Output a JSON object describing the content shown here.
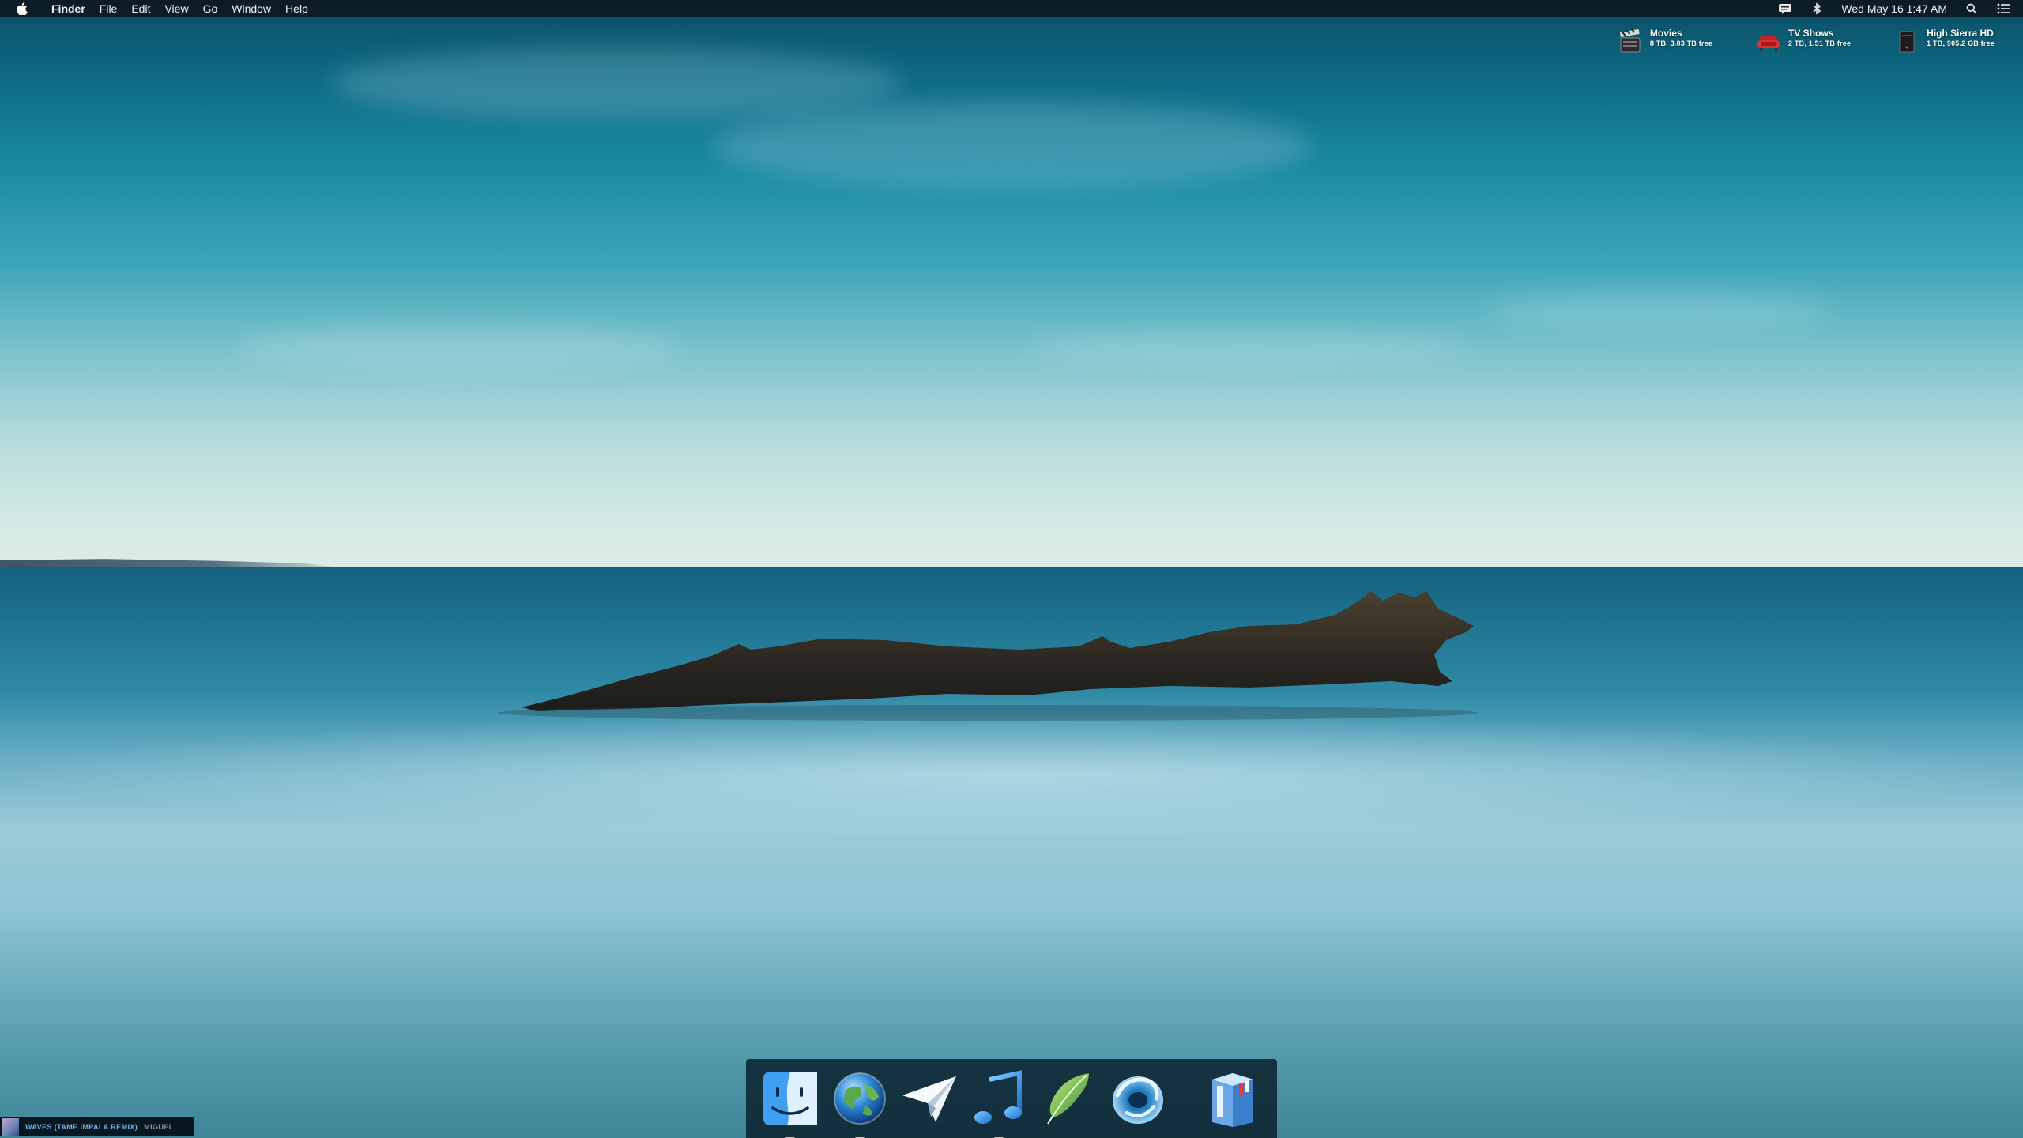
{
  "menubar": {
    "app_name": "Finder",
    "menus": [
      "File",
      "Edit",
      "View",
      "Go",
      "Window",
      "Help"
    ],
    "clock": "Wed May 16  1:47 AM",
    "status_icons": [
      "growl-icon",
      "bluetooth-icon",
      "search-icon",
      "notification-list-icon"
    ]
  },
  "desktop": {
    "drives": [
      {
        "name": "Movies",
        "info": "8 TB, 3.03 TB free",
        "icon": "film-clapper-icon"
      },
      {
        "name": "TV Shows",
        "info": "2 TB, 1.51 TB free",
        "icon": "red-couch-icon"
      },
      {
        "name": "High Sierra HD",
        "info": "1 TB, 905.2 GB free",
        "icon": "hard-drive-icon"
      }
    ]
  },
  "dock": {
    "apps": [
      {
        "name": "Finder",
        "icon": "finder-icon",
        "running": true
      },
      {
        "name": "Browser",
        "icon": "globe-icon",
        "running": true
      },
      {
        "name": "Mail",
        "icon": "paper-plane-icon",
        "running": false
      },
      {
        "name": "Music",
        "icon": "music-note-icon",
        "running": true
      },
      {
        "name": "Feather",
        "icon": "feather-icon",
        "running": false
      },
      {
        "name": "Droplet",
        "icon": "water-swirl-icon",
        "running": false
      }
    ],
    "trailing": {
      "name": "Archive",
      "icon": "archive-box-icon"
    }
  },
  "now_playing": {
    "title": "WAVES (TAME IMPALA REMIX)",
    "artist": "MIGUEL"
  },
  "colors": {
    "menubar_bg": "#0c161e",
    "accent_blue": "#6fb4ef",
    "sky_top": "#0a4d63",
    "sea_mid": "#9bcbd9"
  }
}
